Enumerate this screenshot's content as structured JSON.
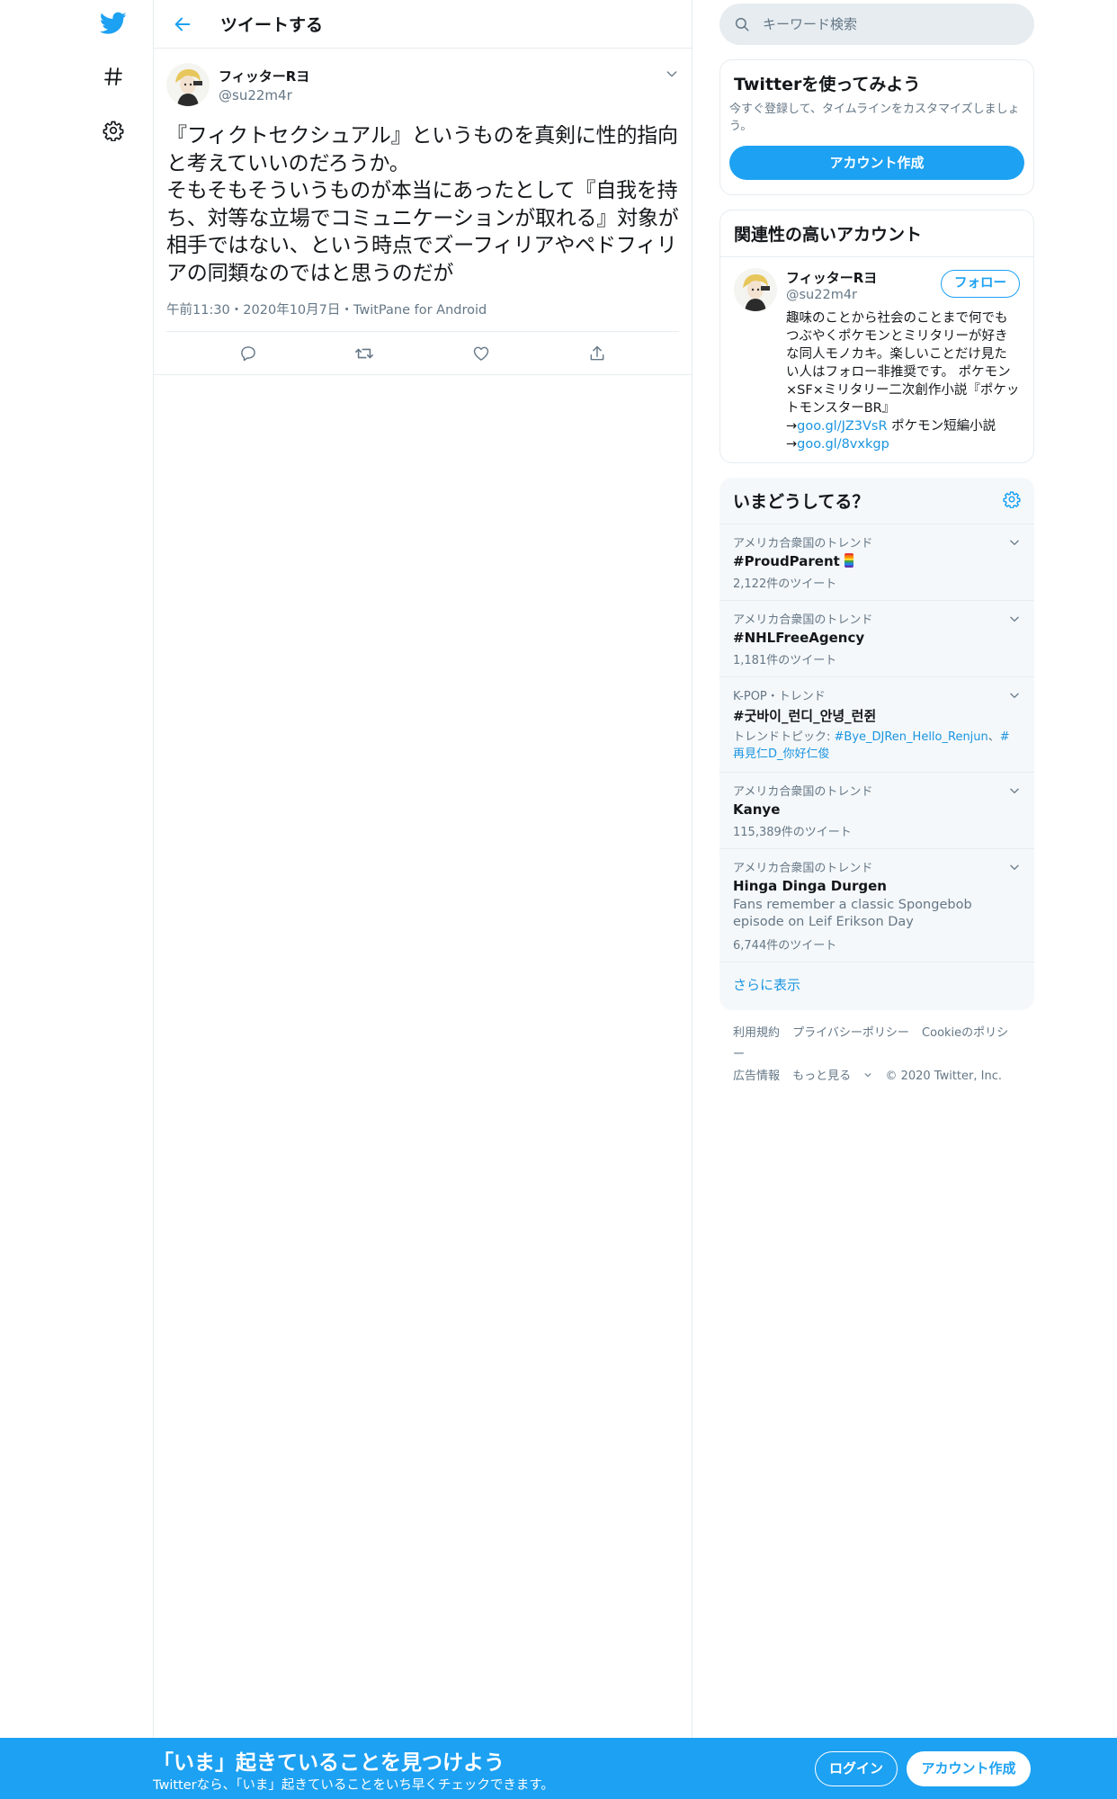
{
  "header": {
    "title": "ツイートする"
  },
  "tweet": {
    "author_name": "フィッターRヨ",
    "author_handle": "@su22m4r",
    "text": "『フィクトセクシュアル』というものを真剣に性的指向と考えていいのだろうか。\nそもそもそういうものが本当にあったとして『自我を持ち、対等な立場でコミュニケーションが取れる』対象が相手ではない、という時点でズーフィリアやペドフィリアの同類なのではと思うのだが",
    "time": "午前11:30",
    "date": "2020年10月7日",
    "source": "TwitPane for Android",
    "sep": "・"
  },
  "search": {
    "placeholder": "キーワード検索"
  },
  "signup_card": {
    "title": "Twitterを使ってみよう",
    "desc": "今すぐ登録して、タイムラインをカスタマイズしましょう。",
    "button": "アカウント作成"
  },
  "related": {
    "title": "関連性の高いアカウント",
    "name": "フィッターRヨ",
    "handle": "@su22m4r",
    "follow": "フォロー",
    "bio_text": "趣味のことから社会のことまで何でもつぶやくポケモンとミリタリーが好きな同人モノカキ。楽しいことだけ見たい人はフォロー非推奨です。 ポケモン×SF×ミリタリー二次創作小説『ポケットモンスターBR』",
    "arrow": "→",
    "link1": "goo.gl/JZ3VsR",
    "link1_suffix": " ポケモン短編小説",
    "link2": "goo.gl/8vxkgp"
  },
  "trends": {
    "title": "いまどうしてる？",
    "items": [
      {
        "context": "アメリカ合衆国のトレンド",
        "name": "#ProudParent",
        "sub": "2,122件のツイート"
      },
      {
        "context": "アメリカ合衆国のトレンド",
        "name": "#NHLFreeAgency",
        "sub": "1,181件のツイート"
      },
      {
        "context": "K-POP・トレンド",
        "name": "#굿바이_런디_안녕_런쥔",
        "topics_label": "トレンドトピック: ",
        "topic1": "#Bye_DJRen_Hello_Renjun",
        "topic_sep": "、",
        "topic2": "#再見仁D_你好仁俊"
      },
      {
        "context": "アメリカ合衆国のトレンド",
        "name": "Kanye",
        "sub": "115,389件のツイート"
      },
      {
        "context": "アメリカ合衆国のトレンド",
        "name": "Hinga Dinga Durgen",
        "desc": "Fans remember a classic Spongebob episode on Leif Erikson Day",
        "sub": "6,744件のツイート"
      }
    ],
    "show_more": "さらに表示"
  },
  "footer": {
    "terms": "利用規約",
    "privacy": "プライバシーポリシー",
    "cookie": "Cookieのポリシー",
    "ads": "広告情報",
    "more": "もっと見る",
    "copyright": "© 2020 Twitter, Inc."
  },
  "bottom_bar": {
    "title": "「いま」起きていることを見つけよう",
    "sub": "Twitterなら、「いま」起きていることをいち早くチェックできます。",
    "login": "ログイン",
    "signup": "アカウント作成"
  },
  "colors": {
    "accent": "#1da1f2",
    "link": "#1b95e0",
    "secondary_text": "#657786",
    "border": "#e6ecf0"
  }
}
